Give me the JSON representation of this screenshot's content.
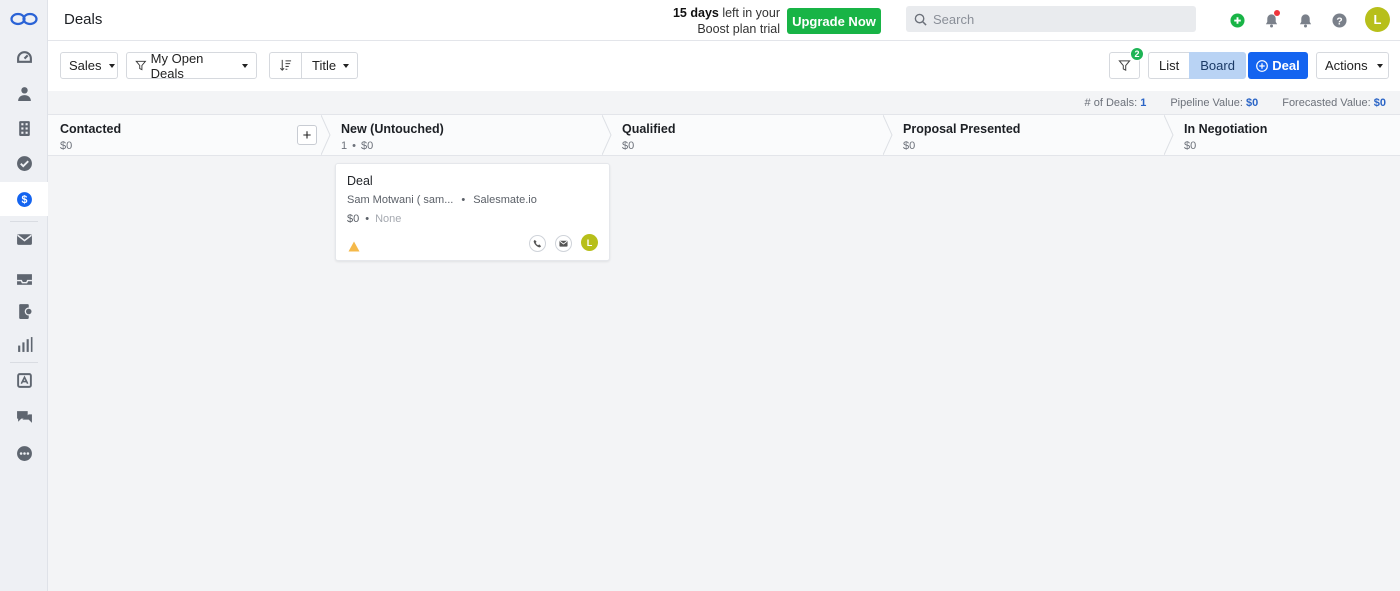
{
  "header": {
    "title": "Deals",
    "trial_days": "15 days",
    "trial_rest_line1": " left in your",
    "trial_line2": "Boost plan trial",
    "upgrade_label": "Upgrade Now",
    "search_placeholder": "Search",
    "user_initial": "L"
  },
  "sidebar": {
    "items": [
      {
        "icon": "dashboard-icon"
      },
      {
        "icon": "contacts-icon"
      },
      {
        "icon": "companies-icon"
      },
      {
        "icon": "tasks-icon"
      },
      {
        "icon": "deals-icon",
        "active": true
      },
      {
        "icon": "email-icon"
      },
      {
        "icon": "inbox-icon"
      },
      {
        "icon": "products-icon"
      },
      {
        "icon": "reports-icon"
      },
      {
        "icon": "automation-icon"
      },
      {
        "icon": "chat-icon"
      },
      {
        "icon": "more-icon"
      }
    ]
  },
  "toolbar": {
    "pipeline": "Sales",
    "view_filter": "My Open Deals",
    "sort_field": "Title",
    "filter_count": "2",
    "view_list": "List",
    "view_board": "Board",
    "add_deal": "Deal",
    "actions": "Actions"
  },
  "stats": {
    "deals_label": "# of Deals:",
    "deals_value": "1",
    "pipeline_label": "Pipeline Value:",
    "pipeline_value": "$0",
    "forecast_label": "Forecasted Value:",
    "forecast_value": "$0"
  },
  "stages": [
    {
      "name": "Contacted",
      "count": "",
      "value": "$0"
    },
    {
      "name": "New (Untouched)",
      "count": "1",
      "value": "$0"
    },
    {
      "name": "Qualified",
      "count": "",
      "value": "$0"
    },
    {
      "name": "Proposal Presented",
      "count": "",
      "value": "$0"
    },
    {
      "name": "In Negotiation",
      "count": "",
      "value": "$0"
    }
  ],
  "deal_card": {
    "title": "Deal",
    "contact": "Sam Motwani ( sam...",
    "company": "Salesmate.io",
    "value": "$0",
    "priority": "None",
    "owner_initial": "L"
  },
  "colors": {
    "primary": "#1464f0",
    "upgrade": "#18b446",
    "avatar": "#b7bf1a",
    "warning": "#f5b94a"
  }
}
